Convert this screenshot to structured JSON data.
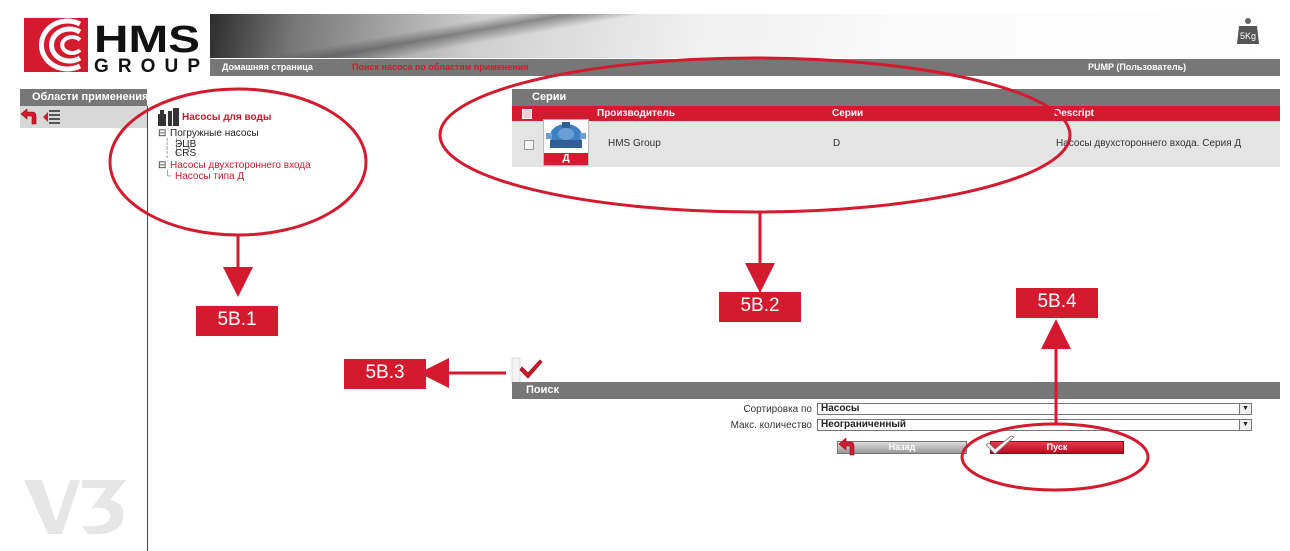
{
  "header": {
    "logo_text_top": "HMS",
    "logo_text_bottom": "GROUP",
    "nav_home": "Домашняя страница",
    "nav_current": "Поиск насоса по областям применения",
    "user": "PUMP (Пользователь)",
    "weight_icon_label": "5Kg"
  },
  "sidebar": {
    "title": "Области применения",
    "icons": [
      "back-arrow-icon",
      "collapse-tree-icon"
    ]
  },
  "tree": {
    "root": "Насосы для воды",
    "group1": "Погружные насосы",
    "group1_items": [
      "ЭЦВ",
      "CRS"
    ],
    "group2": "Насосы двухстороннего входа",
    "group2_items": [
      "Насосы типа Д"
    ]
  },
  "series": {
    "title": "Серии",
    "columns": [
      "Производитель",
      "Серии",
      "Descript"
    ],
    "rows": [
      {
        "manufacturer": "HMS Group",
        "series": "D",
        "description": "Насосы двухстороннего входа. Серия Д",
        "badge": "Д"
      }
    ]
  },
  "search": {
    "title": "Поиск",
    "sort_label": "Сортировка по",
    "sort_value": "Насосы",
    "max_label": "Макс. количество",
    "max_value": "Неограниченный",
    "back_label": "Назад",
    "go_label": "Пуск"
  },
  "annotations": {
    "a1": "5B.1",
    "a2": "5B.2",
    "a3": "5B.3",
    "a4": "5B.4"
  },
  "colors": {
    "accent": "#d31a2e",
    "bar_gray": "#777777",
    "row_gray": "#e4e4e4"
  }
}
